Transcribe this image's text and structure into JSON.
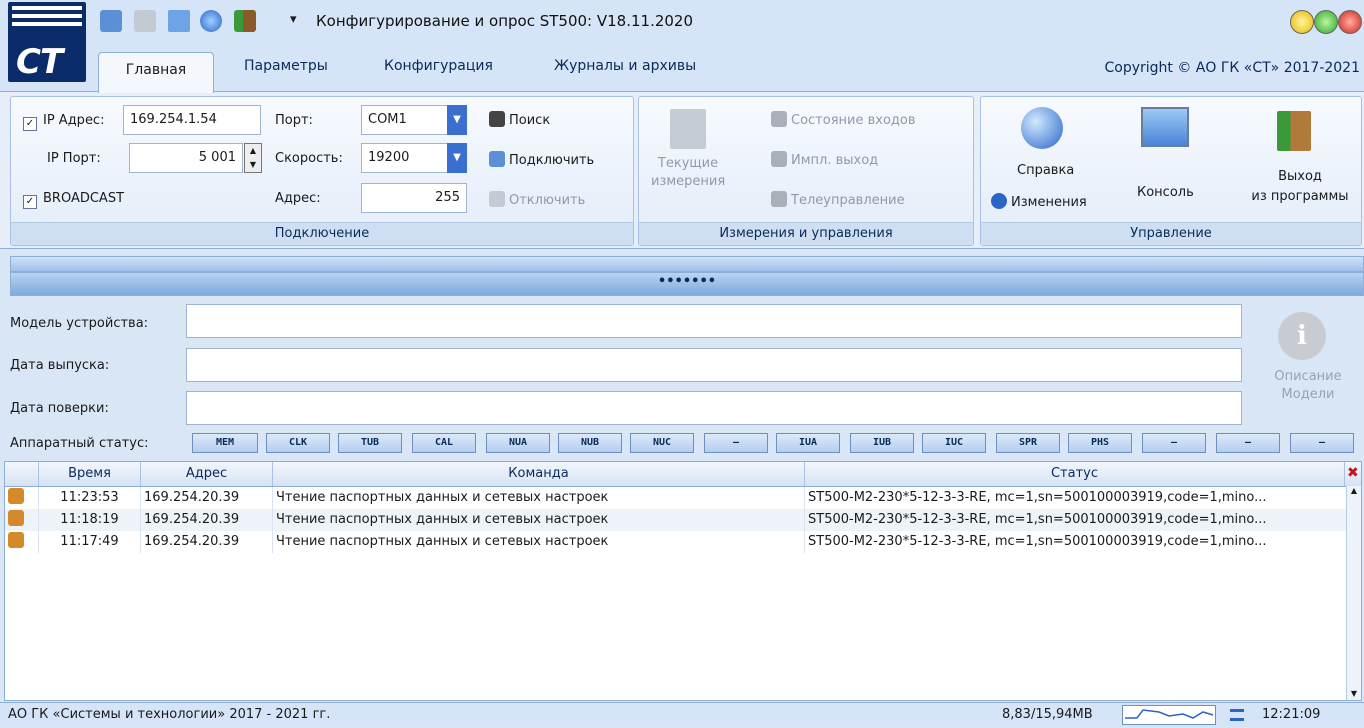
{
  "app": {
    "title": "Конфигурирование и опрос ST500: V18.11.2020",
    "logo_text": "CT",
    "quick_access": [
      "connect-icon",
      "disconnect-icon",
      "console-icon",
      "help-globe-icon",
      "exit-icon"
    ]
  },
  "tabs": [
    {
      "label": "Главная",
      "active": true
    },
    {
      "label": "Параметры"
    },
    {
      "label": "Конфигурация"
    },
    {
      "label": "Журналы и архивы"
    }
  ],
  "copyright": "Copyright © АО ГК «СТ» 2017-2021",
  "connection": {
    "caption": "Подключение",
    "ip_checkbox_label": "IP Адрес:",
    "ip_value": "169.254.1.54",
    "ip_port_label": "IP Порт:",
    "ip_port_value": "5 001",
    "broadcast_label": "BROADCAST",
    "port_label": "Порт:",
    "port_value": "COM1",
    "speed_label": "Скорость:",
    "speed_value": "19200",
    "address_label": "Адрес:",
    "address_value": "255",
    "search_label": "Поиск",
    "connect_label": "Подключить",
    "disconnect_label": "Отключить"
  },
  "measurements": {
    "caption": "Измерения и управления",
    "current_label_1": "Текущие",
    "current_label_2": "измерения",
    "inputs_label": "Состояние входов",
    "pulse_label": "Импл. выход",
    "telecontrol_label": "Телеуправление"
  },
  "management": {
    "caption": "Управление",
    "help_label": "Справка",
    "changes_label": "Изменения",
    "console_label": "Консоль",
    "exit_label_1": "Выход",
    "exit_label_2": "из программы"
  },
  "status_dots": "•••••••",
  "device": {
    "model_label": "Модель устройства:",
    "release_label": "Дата выпуска:",
    "verify_label": "Дата поверки:",
    "model_value": "",
    "release_value": "",
    "verify_value": "",
    "description_1": "Описание",
    "description_2": "Модели"
  },
  "hw_status": {
    "label": "Аппаратный статус:",
    "indicators": [
      "MEM",
      "CLK",
      "TUB",
      "CAL",
      "NUA",
      "NUB",
      "NUC",
      "–",
      "IUA",
      "IUB",
      "IUC",
      "SPR",
      "PHS",
      "–",
      "–",
      "–"
    ]
  },
  "log": {
    "columns": [
      "Время",
      "Адрес",
      "Команда",
      "Статус"
    ],
    "rows": [
      {
        "time": "11:23:53",
        "address": "169.254.20.39",
        "command": "Чтение паспортных данных и сетевых настроек",
        "status": "ST500-M2-230*5-12-3-3-RE, mc=1,sn=500100003919,code=1,mino..."
      },
      {
        "time": "11:18:19",
        "address": "169.254.20.39",
        "command": "Чтение паспортных данных и сетевых настроек",
        "status": "ST500-M2-230*5-12-3-3-RE, mc=1,sn=500100003919,code=1,mino..."
      },
      {
        "time": "11:17:49",
        "address": "169.254.20.39",
        "command": "Чтение паспортных данных и сетевых настроек",
        "status": "ST500-M2-230*5-12-3-3-RE, mc=1,sn=500100003919,code=1,mino..."
      }
    ]
  },
  "statusbar": {
    "company": "АО ГК «Системы и технологии» 2017 - 2021 гг.",
    "memory": "8,83/15,94MB",
    "time": "12:21:09"
  },
  "colors": {
    "accent": "#3a6fd0",
    "logo_bg": "#0a2c6b",
    "window_bg": "#d5e4f6"
  }
}
